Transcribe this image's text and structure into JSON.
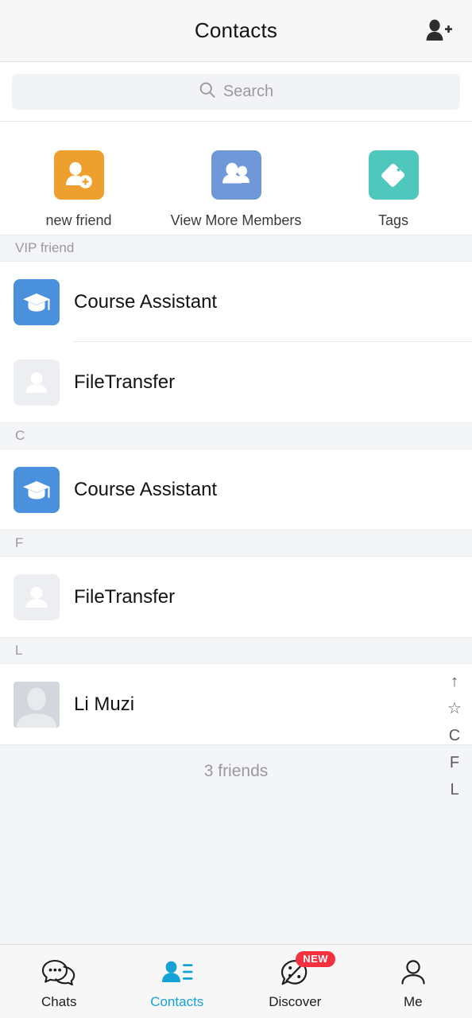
{
  "header": {
    "title": "Contacts",
    "add_contact_icon": "add-person-icon"
  },
  "search": {
    "placeholder": "Search",
    "icon": "search-icon"
  },
  "shortcuts": [
    {
      "label": "new friend",
      "icon": "person-add-icon",
      "color": "#eda02e"
    },
    {
      "label": "View More Members",
      "icon": "group-icon",
      "color": "#6f98d8"
    },
    {
      "label": "Tags",
      "icon": "tag-icon",
      "color": "#4ec8bd"
    }
  ],
  "sections": [
    {
      "title": "VIP friend",
      "contacts": [
        {
          "name": "Course Assistant",
          "avatar": "graduation-cap-avatar"
        },
        {
          "name": "FileTransfer",
          "avatar": "person-placeholder-avatar"
        }
      ]
    },
    {
      "title": "C",
      "contacts": [
        {
          "name": "Course Assistant",
          "avatar": "graduation-cap-avatar"
        }
      ]
    },
    {
      "title": "F",
      "contacts": [
        {
          "name": "FileTransfer",
          "avatar": "person-placeholder-avatar"
        }
      ]
    },
    {
      "title": "L",
      "contacts": [
        {
          "name": "Li Muzi",
          "avatar": "person-photo-avatar"
        }
      ]
    }
  ],
  "footer": {
    "friends_count": "3 friends"
  },
  "index_bar": {
    "items": [
      "↑",
      "☆",
      "C",
      "F",
      "L"
    ]
  },
  "tabbar": {
    "active": "Contacts",
    "tabs": [
      {
        "label": "Chats",
        "icon": "chat-bubbles-icon",
        "badge": ""
      },
      {
        "label": "Contacts",
        "icon": "contacts-person-icon",
        "badge": ""
      },
      {
        "label": "Discover",
        "icon": "discover-compass-icon",
        "badge": "NEW"
      },
      {
        "label": "Me",
        "icon": "person-outline-icon",
        "badge": ""
      }
    ]
  },
  "colors": {
    "accent": "#14a2d6",
    "badge": "#f5313f",
    "header_bg": "#f7f7f7",
    "section_bg": "#f4f5f6"
  }
}
